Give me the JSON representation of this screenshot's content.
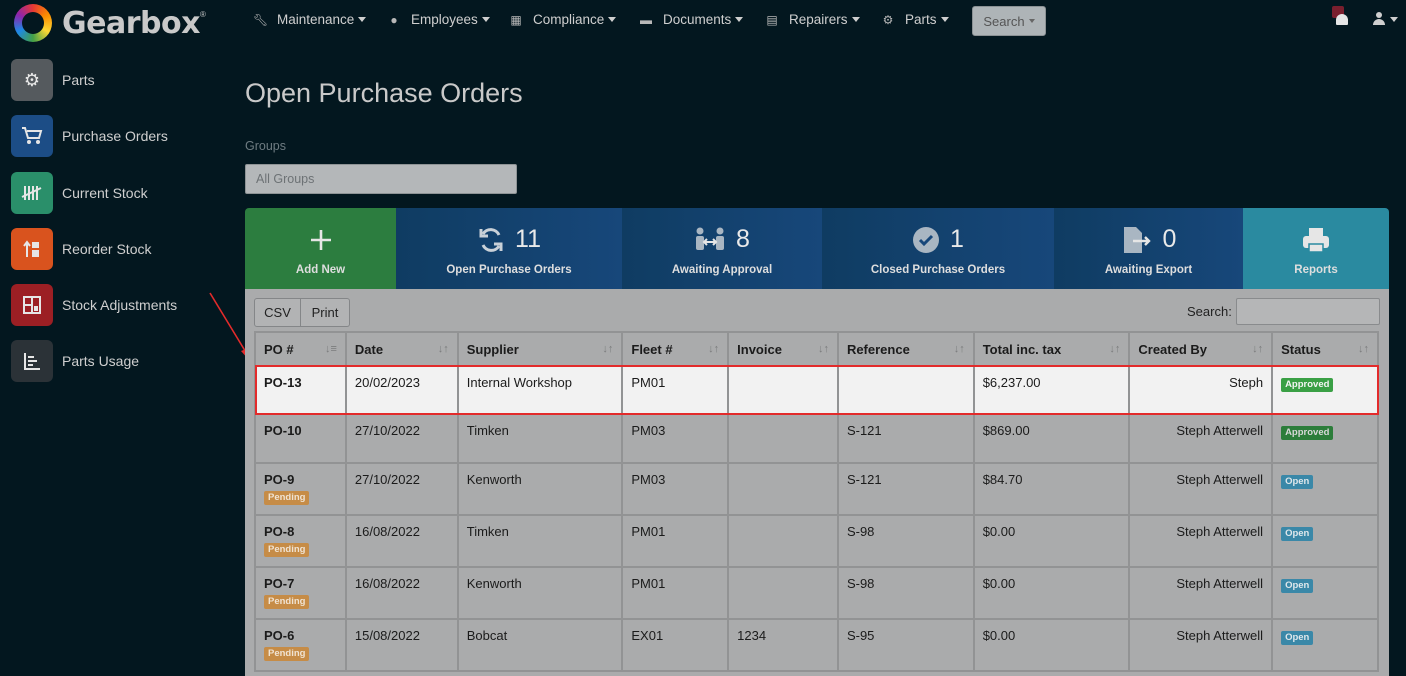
{
  "app": {
    "name": "Gearbox"
  },
  "nav": {
    "items": [
      {
        "label": "Maintenance",
        "icon": "wrench-icon"
      },
      {
        "label": "Employees",
        "icon": "user-circle-icon"
      },
      {
        "label": "Compliance",
        "icon": "calendar-icon"
      },
      {
        "label": "Documents",
        "icon": "folder-icon"
      },
      {
        "label": "Repairers",
        "icon": "address-book-icon"
      },
      {
        "label": "Parts",
        "icon": "gear-icon"
      }
    ],
    "search_label": "Search"
  },
  "sidebar": {
    "items": [
      {
        "label": "Parts",
        "icon": "gears-icon",
        "color": "#555a5e"
      },
      {
        "label": "Purchase Orders",
        "icon": "cart-icon",
        "color": "#1c4d86"
      },
      {
        "label": "Current Stock",
        "icon": "tally-icon",
        "color": "#2a8f6a"
      },
      {
        "label": "Reorder Stock",
        "icon": "reorder-icon",
        "color": "#d9531e"
      },
      {
        "label": "Stock Adjustments",
        "icon": "adjust-icon",
        "color": "#9c1f24"
      },
      {
        "label": "Parts Usage",
        "icon": "bar-chart-icon",
        "color": "#2b3237"
      }
    ]
  },
  "page": {
    "title": "Open Purchase Orders",
    "groups_label": "Groups",
    "groups_value": "All Groups"
  },
  "tiles": {
    "add": {
      "label": "Add New"
    },
    "open": {
      "count": "11",
      "label": "Open Purchase Orders"
    },
    "awaiting": {
      "count": "8",
      "label": "Awaiting Approval"
    },
    "closed": {
      "count": "1",
      "label": "Closed Purchase Orders"
    },
    "export": {
      "count": "0",
      "label": "Awaiting Export"
    },
    "reports": {
      "label": "Reports"
    }
  },
  "table": {
    "csv_label": "CSV",
    "print_label": "Print",
    "search_label": "Search:",
    "headers": [
      "PO #",
      "Date",
      "Supplier",
      "Fleet #",
      "Invoice",
      "Reference",
      "Total inc. tax",
      "Created By",
      "Status"
    ],
    "rows": [
      {
        "po": "PO-13",
        "pending": "",
        "date": "20/02/2023",
        "supplier": "Internal Workshop",
        "fleet": "PM01",
        "invoice": "",
        "reference": "",
        "total": "$6,237.00",
        "created_by": "Steph",
        "status": "Approved"
      },
      {
        "po": "PO-10",
        "pending": "",
        "date": "27/10/2022",
        "supplier": "Timken",
        "fleet": "PM03",
        "invoice": "",
        "reference": "S-121",
        "total": "$869.00",
        "created_by": "Steph Atterwell",
        "status": "Approved"
      },
      {
        "po": "PO-9",
        "pending": "Pending",
        "date": "27/10/2022",
        "supplier": "Kenworth",
        "fleet": "PM03",
        "invoice": "",
        "reference": "S-121",
        "total": "$84.70",
        "created_by": "Steph Atterwell",
        "status": "Open"
      },
      {
        "po": "PO-8",
        "pending": "Pending",
        "date": "16/08/2022",
        "supplier": "Timken",
        "fleet": "PM01",
        "invoice": "",
        "reference": "S-98",
        "total": "$0.00",
        "created_by": "Steph Atterwell",
        "status": "Open"
      },
      {
        "po": "PO-7",
        "pending": "Pending",
        "date": "16/08/2022",
        "supplier": "Kenworth",
        "fleet": "PM01",
        "invoice": "",
        "reference": "S-98",
        "total": "$0.00",
        "created_by": "Steph Atterwell",
        "status": "Open"
      },
      {
        "po": "PO-6",
        "pending": "Pending",
        "date": "15/08/2022",
        "supplier": "Bobcat",
        "fleet": "EX01",
        "invoice": "1234",
        "reference": "S-95",
        "total": "$0.00",
        "created_by": "Steph Atterwell",
        "status": "Open"
      }
    ]
  },
  "colors": {
    "background": "#03171f",
    "highlight_border": "#e32b2b",
    "approved": "#3aa045",
    "open": "#3a88a8",
    "pending": "#c68c47"
  }
}
